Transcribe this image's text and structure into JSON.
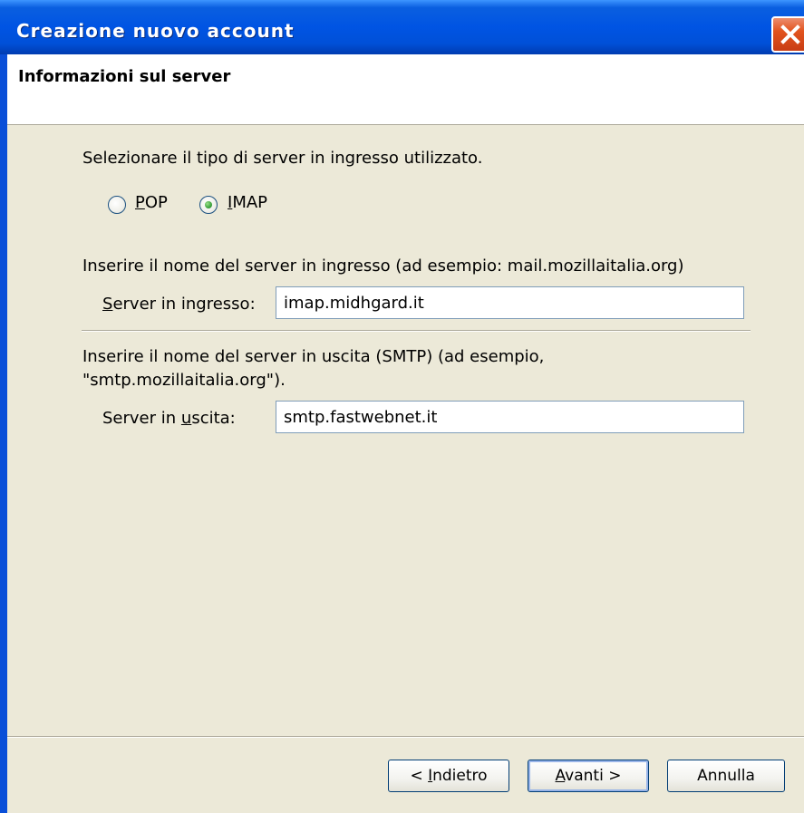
{
  "window": {
    "title": "Creazione nuovo account",
    "close_icon": "close-icon"
  },
  "header": {
    "title": "Informazioni sul server"
  },
  "server_type": {
    "prompt": "Selezionare il tipo di server in ingresso utilizzato.",
    "options": [
      {
        "label_prefix": "",
        "label_accel": "P",
        "label_suffix": "OP",
        "selected": false
      },
      {
        "label_prefix": "",
        "label_accel": "I",
        "label_suffix": "MAP",
        "selected": true
      }
    ]
  },
  "incoming": {
    "prompt": "Inserire il nome del server in ingresso (ad esempio: mail.mozillaitalia.org)",
    "label_accel": "S",
    "label_rest": "erver in ingresso:",
    "value": "imap.midhgard.it"
  },
  "outgoing": {
    "prompt_line1": "Inserire il nome del server in uscita (SMTP) (ad esempio,",
    "prompt_line2": "\"smtp.mozillaitalia.org\").",
    "label_before": "Server in ",
    "label_accel": "u",
    "label_after": "scita:",
    "value": "smtp.fastwebnet.it"
  },
  "buttons": {
    "back_prefix": "< ",
    "back_accel": "I",
    "back_rest": "ndietro",
    "next_accel": "A",
    "next_rest": "vanti >",
    "cancel": "Annulla"
  }
}
